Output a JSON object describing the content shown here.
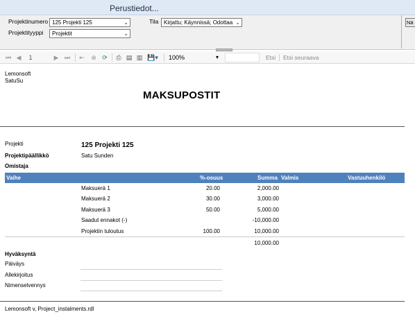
{
  "window": {
    "title": "Perustiedot..."
  },
  "params": {
    "project_number_label": "Projektinumero",
    "project_number_value": "125 Projekti 125",
    "project_type_label": "Projektityyppi",
    "project_type_value": "Projektit",
    "status_label": "Tila",
    "status_value": "Kirjattu; Käynnissä; Odottaa; Ke",
    "view_button": "Nä"
  },
  "toolbar": {
    "page_number": "1",
    "zoom": "100%",
    "find_label": "Etsi",
    "find_next_label": "Etsi seuraava"
  },
  "report": {
    "company": "Lemonsoft",
    "user": "SatuSu",
    "title": "MAKSUPOSTIT",
    "project_label": "Projekti",
    "project_value": "125 Projekti 125",
    "manager_label": "Projektipäällikkö",
    "manager_value": "Satu Sunden",
    "owner_label": "Omistaja",
    "columns": [
      "Vaihe",
      "%-osuus",
      "Summa",
      "Valmis",
      "Vastuuhenkilö"
    ],
    "rows": [
      {
        "name": "Maksuerä 1",
        "percent": "20.00",
        "sum": "2,000.00"
      },
      {
        "name": "Maksuerä 2",
        "percent": "30.00",
        "sum": "3,000.00"
      },
      {
        "name": "Maksuerä 3",
        "percent": "50.00",
        "sum": "5,000.00"
      },
      {
        "name": "Saadut ennakot (-)",
        "percent": "",
        "sum": "-10,000.00"
      },
      {
        "name": "Projektin tuloutus",
        "percent": "100.00",
        "sum": "10,000.00"
      }
    ],
    "total": "10,000.00",
    "approval_title": "Hyväksyntä",
    "date_label": "Päiväys",
    "signature_label": "Allekirjoitus",
    "name_clarification_label": "Nimenselvennys",
    "footer": "Lemonsoft v, Project_instalments.rdl"
  },
  "colors": {
    "header_bg": "#4f81bd",
    "titlebar_bg": "#dfe9f5",
    "panel_bg": "#f0f0f0"
  }
}
